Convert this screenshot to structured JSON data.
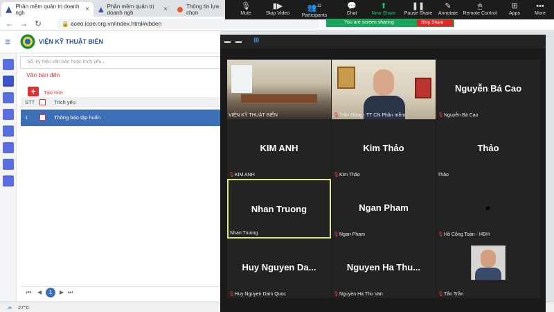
{
  "browser": {
    "tabs": [
      {
        "label": "Phần mềm quản trị doanh ngh",
        "active": true
      },
      {
        "label": "Phần mềm quản trị doanh ngh",
        "active": false
      },
      {
        "label": "Thông tin lựa chọn",
        "active": false
      }
    ],
    "url": "aceo.icoe.org.vn/index.html#vbden"
  },
  "app": {
    "brand": "VIỆN KỸ THUẬT BIỂN",
    "search_placeholder": "Số, ký hiệu văn bản hoặc trích yếu...",
    "section_title": "Văn bản đến",
    "add_icon": "+",
    "add_label": "Tạo mới",
    "table": {
      "headers": [
        "STT",
        "Trích yếu"
      ],
      "rows": [
        {
          "stt": "1",
          "summary": "Thông báo tập huấn"
        }
      ]
    },
    "pager": {
      "current_page": "1"
    }
  },
  "zoom": {
    "toolbar": [
      {
        "label": "Mute",
        "icon": "microphone-icon",
        "glyph": "🎙"
      },
      {
        "label": "Stop Video",
        "icon": "video-camera-icon",
        "glyph": "▮▶"
      },
      {
        "label": "Participants",
        "icon": "participants-icon",
        "glyph": "👥",
        "count": "12"
      },
      {
        "label": "Chat",
        "icon": "chat-icon",
        "glyph": "💬"
      },
      {
        "label": "New Share",
        "icon": "share-arrow-icon",
        "glyph": "⬆"
      },
      {
        "label": "Pause Share",
        "icon": "pause-icon",
        "glyph": "❚❚"
      },
      {
        "label": "Annotate",
        "icon": "annotate-pencil-icon",
        "glyph": "✎"
      },
      {
        "label": "Remote Control",
        "icon": "remote-control-icon",
        "glyph": "🖱"
      },
      {
        "label": "Apps",
        "icon": "apps-grid-icon",
        "glyph": "⊞"
      },
      {
        "label": "More",
        "icon": "more-dots-icon",
        "glyph": "•••"
      }
    ],
    "share_status": "You are screen sharing",
    "stop_share": "Stop Share",
    "tiles": [
      {
        "big": "",
        "small": "VIỆN KỸ THUẬT BIỂN",
        "type": "video-room",
        "muted": false
      },
      {
        "big": "",
        "small": "Trần Dũng - TT CN Phần mềm",
        "type": "video-person",
        "muted": true
      },
      {
        "big": "Nguyễn Bá Cao",
        "small": "Nguyễn Bá Cao",
        "type": "name",
        "muted": true
      },
      {
        "big": "KIM ANH",
        "small": "KIM ANH",
        "type": "name",
        "muted": true
      },
      {
        "big": "Kim Thảo",
        "small": "Kim Thảo",
        "type": "name",
        "muted": true
      },
      {
        "big": "Thảo",
        "small": "Thảo",
        "type": "name",
        "muted": false
      },
      {
        "big": "Nhan Truong",
        "small": "Nhan Truong",
        "type": "name",
        "muted": false,
        "active": true
      },
      {
        "big": "Ngan Pham",
        "small": "Ngan Pham",
        "type": "name",
        "muted": true
      },
      {
        "big": "",
        "small": "Hồ Công Toàn - HĐH",
        "type": "dot",
        "muted": true
      },
      {
        "big": "Huy Nguyen Da...",
        "small": "Huy Nguyen Dam Quoc",
        "type": "name",
        "muted": true
      },
      {
        "big": "Nguyen Ha Thu...",
        "small": "Nguyen Ha Thu Van",
        "type": "name",
        "muted": true
      },
      {
        "big": "",
        "small": "Tân Trần",
        "type": "photo",
        "muted": true
      }
    ]
  },
  "taskbar": {
    "temperature": "27°C"
  },
  "colors": {
    "accent_red": "#e0302f",
    "row_blue": "#3d6fb6",
    "zoom_green": "#1fc46a",
    "active_speaker": "#e5e68c"
  }
}
